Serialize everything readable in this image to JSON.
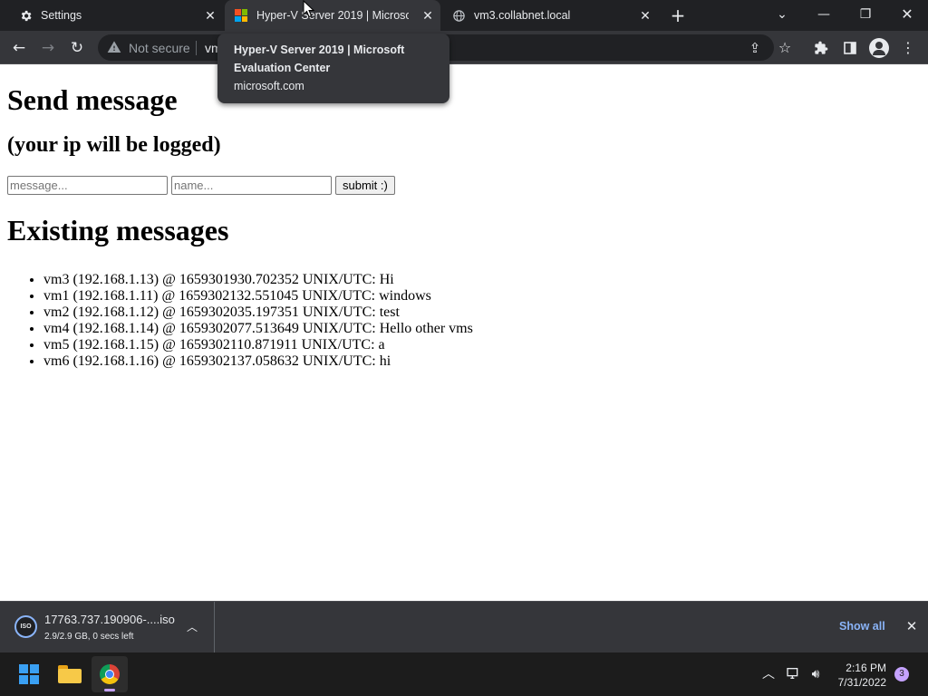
{
  "browser": {
    "tabs": [
      {
        "title": "Settings",
        "favicon": "gear-icon"
      },
      {
        "title": "Hyper-V Server 2019 | Microsoft Evaluation Center",
        "favicon": "microsoft-logo-icon"
      },
      {
        "title": "vm3.collabnet.local",
        "favicon": "globe-icon"
      }
    ],
    "active_tab_index": 1,
    "tooltip": {
      "title": "Hyper-V Server 2019 | Microsoft Evaluation Center",
      "domain": "microsoft.com"
    },
    "omnibox": {
      "security_text": "Not secure",
      "url_text": "vm"
    }
  },
  "page": {
    "heading": "Send message",
    "subheading": "(your ip will be logged)",
    "form": {
      "message_placeholder": "message...",
      "name_placeholder": "name...",
      "submit_label": "submit :)"
    },
    "existing_heading": "Existing messages",
    "messages": [
      "vm3 (192.168.1.13) @ 1659301930.702352 UNIX/UTC: Hi",
      "vm1 (192.168.1.11) @ 1659302132.551045 UNIX/UTC: windows",
      "vm2 (192.168.1.12) @ 1659302035.197351 UNIX/UTC: test",
      "vm4 (192.168.1.14) @ 1659302077.513649 UNIX/UTC: Hello other vms",
      "vm5 (192.168.1.15) @ 1659302110.871911 UNIX/UTC: a",
      "vm6 (192.168.1.16) @ 1659302137.058632 UNIX/UTC: hi"
    ]
  },
  "download_bar": {
    "filename": "17763.737.190906-....iso",
    "status": "2.9/2.9 GB, 0 secs left",
    "file_type": "ISO",
    "show_all_label": "Show all"
  },
  "taskbar": {
    "time": "2:16 PM",
    "date": "7/31/2022",
    "notification_count": "3"
  },
  "colors": {
    "chrome_dark": "#202124",
    "chrome_toolbar": "#35363a",
    "accent_blue": "#8ab4f8",
    "taskbar": "#1c1c1c"
  }
}
